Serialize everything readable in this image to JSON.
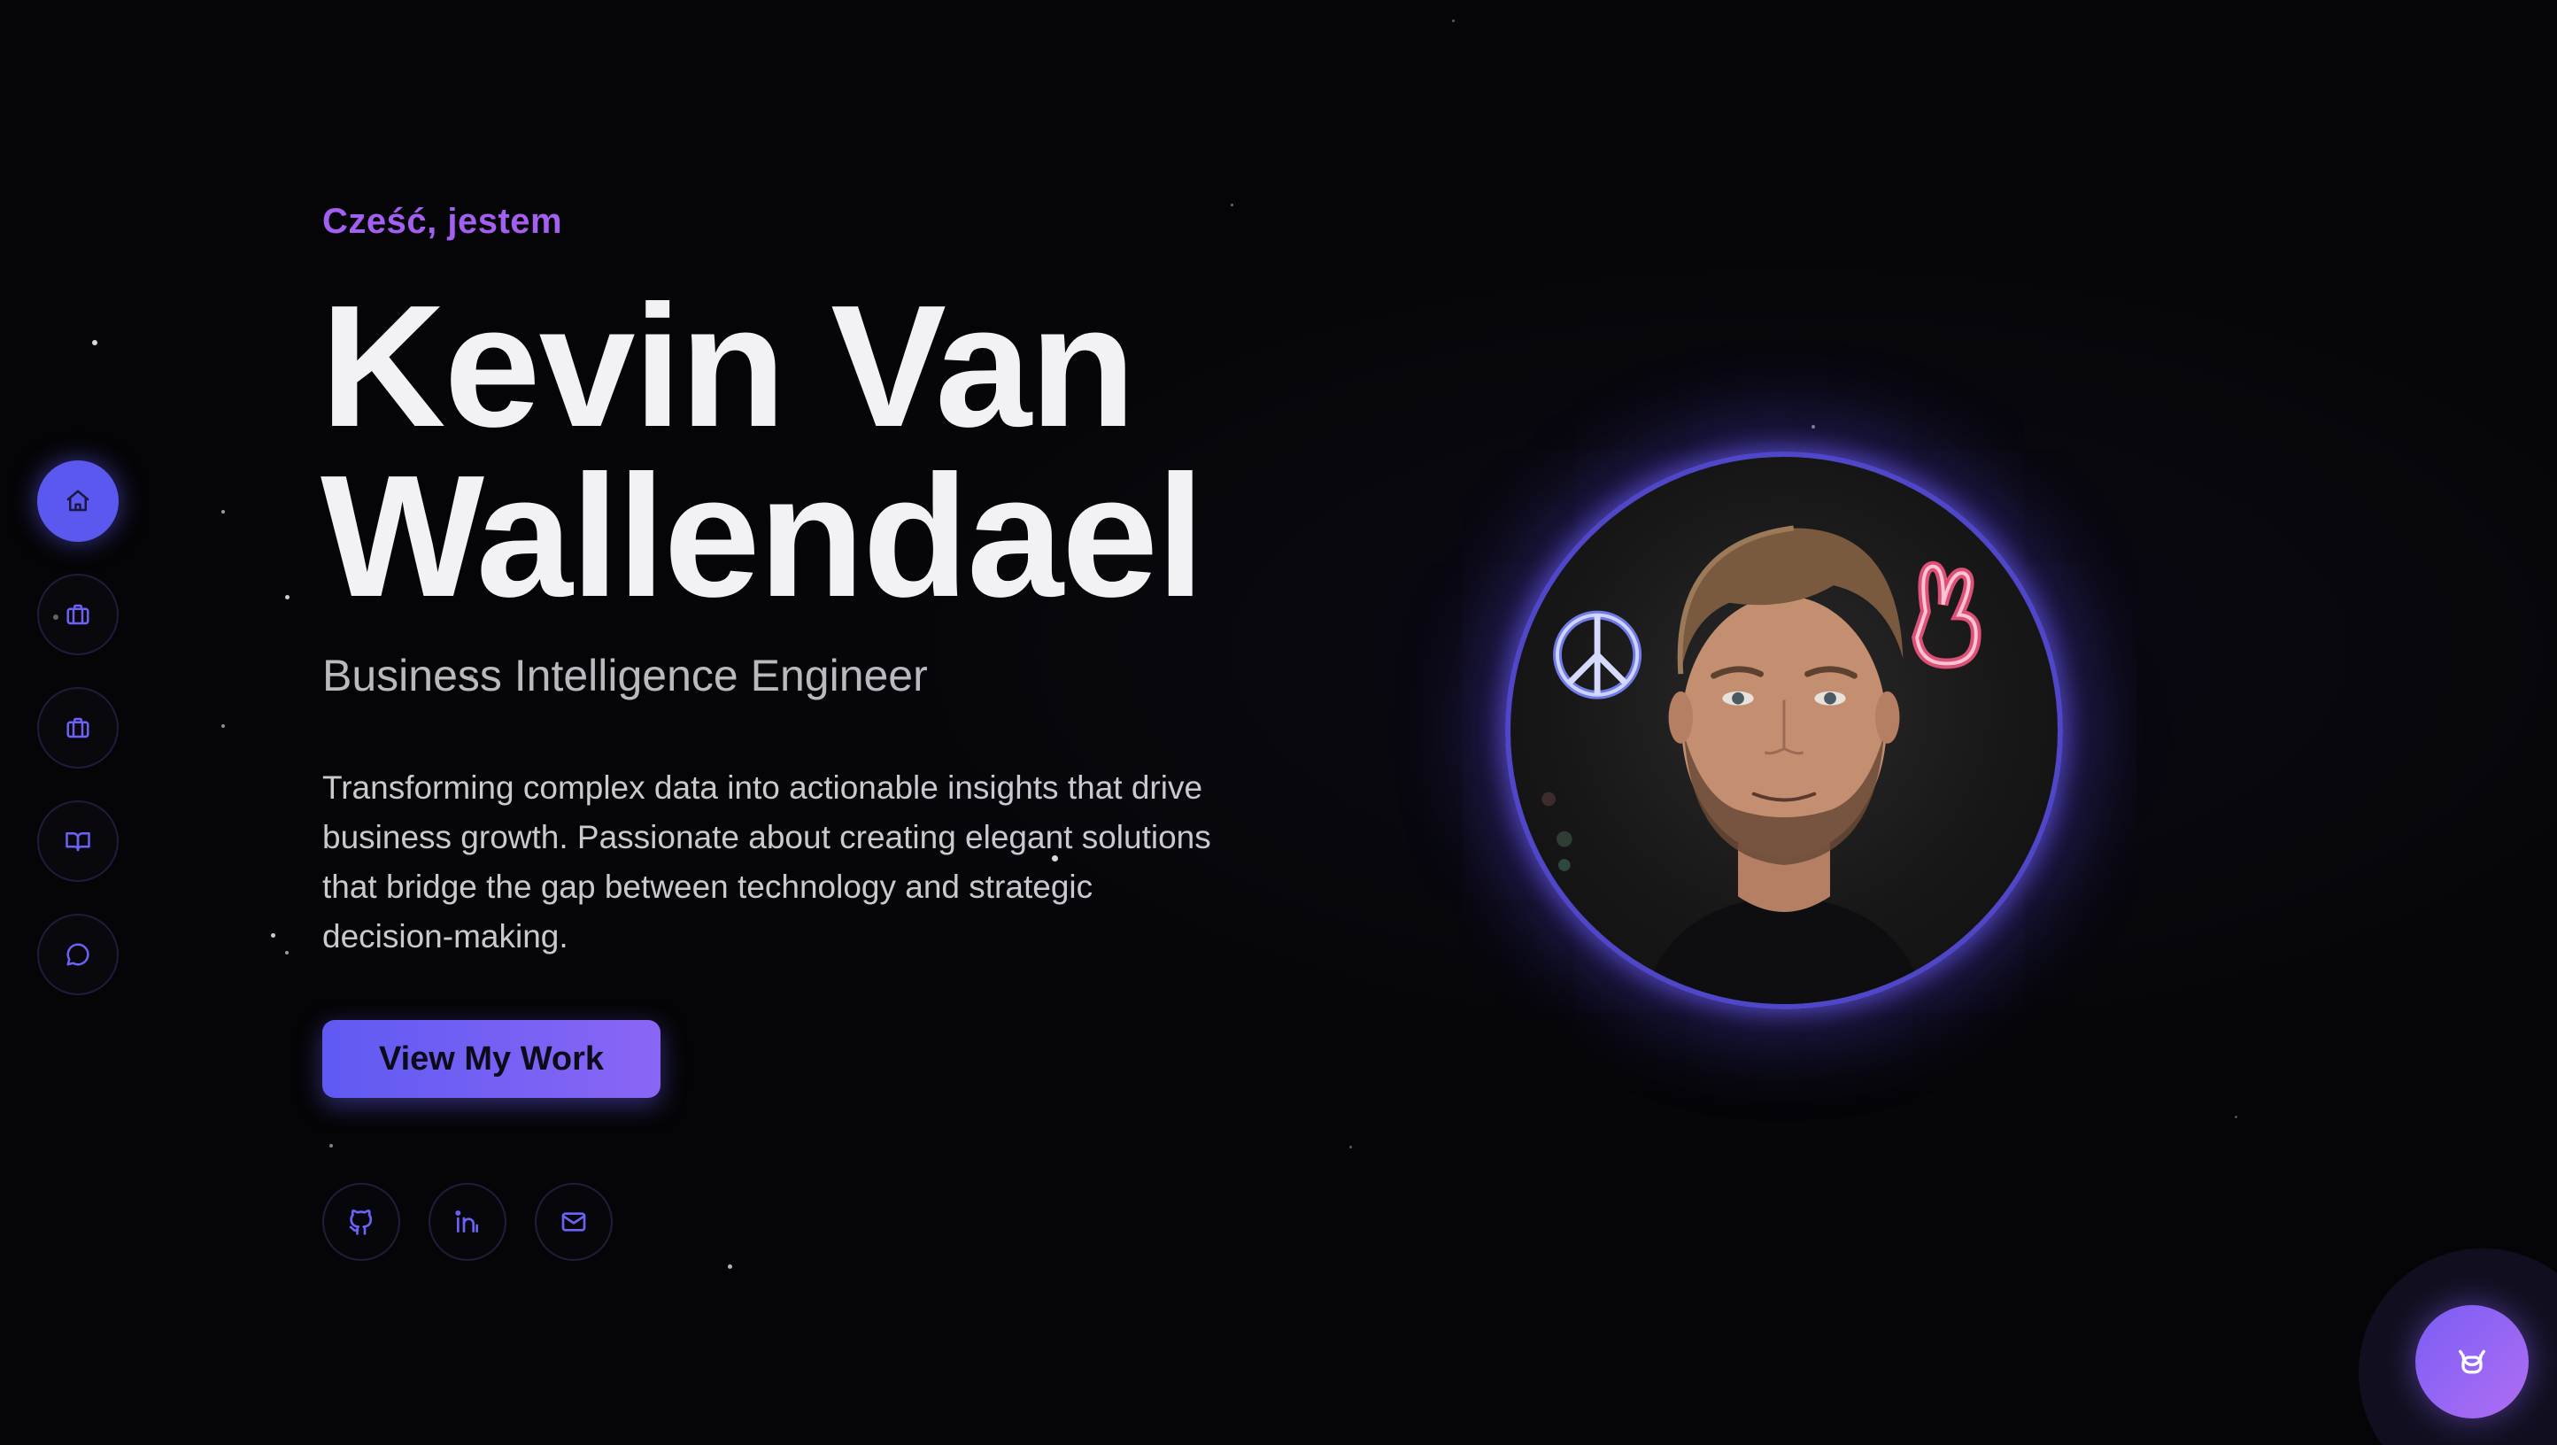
{
  "hero": {
    "greeting": "Cześć, jestem",
    "name": "Kevin Van Wallendael",
    "role": "Business Intelligence Engineer",
    "bio": "Transforming complex data into actionable insights that drive business growth. Passionate about creating elegant solutions that bridge the gap between technology and strategic decision-making.",
    "cta_label": "View My Work"
  },
  "side_nav": {
    "items": [
      {
        "icon": "home-icon",
        "active": true
      },
      {
        "icon": "briefcase-icon",
        "active": false
      },
      {
        "icon": "briefcase-icon",
        "active": false
      },
      {
        "icon": "book-open-icon",
        "active": false
      },
      {
        "icon": "chat-bubble-icon",
        "active": false
      }
    ]
  },
  "social_links": [
    {
      "icon": "github-icon"
    },
    {
      "icon": "linkedin-icon"
    },
    {
      "icon": "mail-icon"
    }
  ],
  "chat_widget": {
    "icon": "bot-icon"
  },
  "colors": {
    "accent": "#5b58f0",
    "accent_purple": "#a35ff0",
    "background": "#050507",
    "text_primary": "#f2f2f4",
    "text_secondary": "#b9b9c0"
  }
}
